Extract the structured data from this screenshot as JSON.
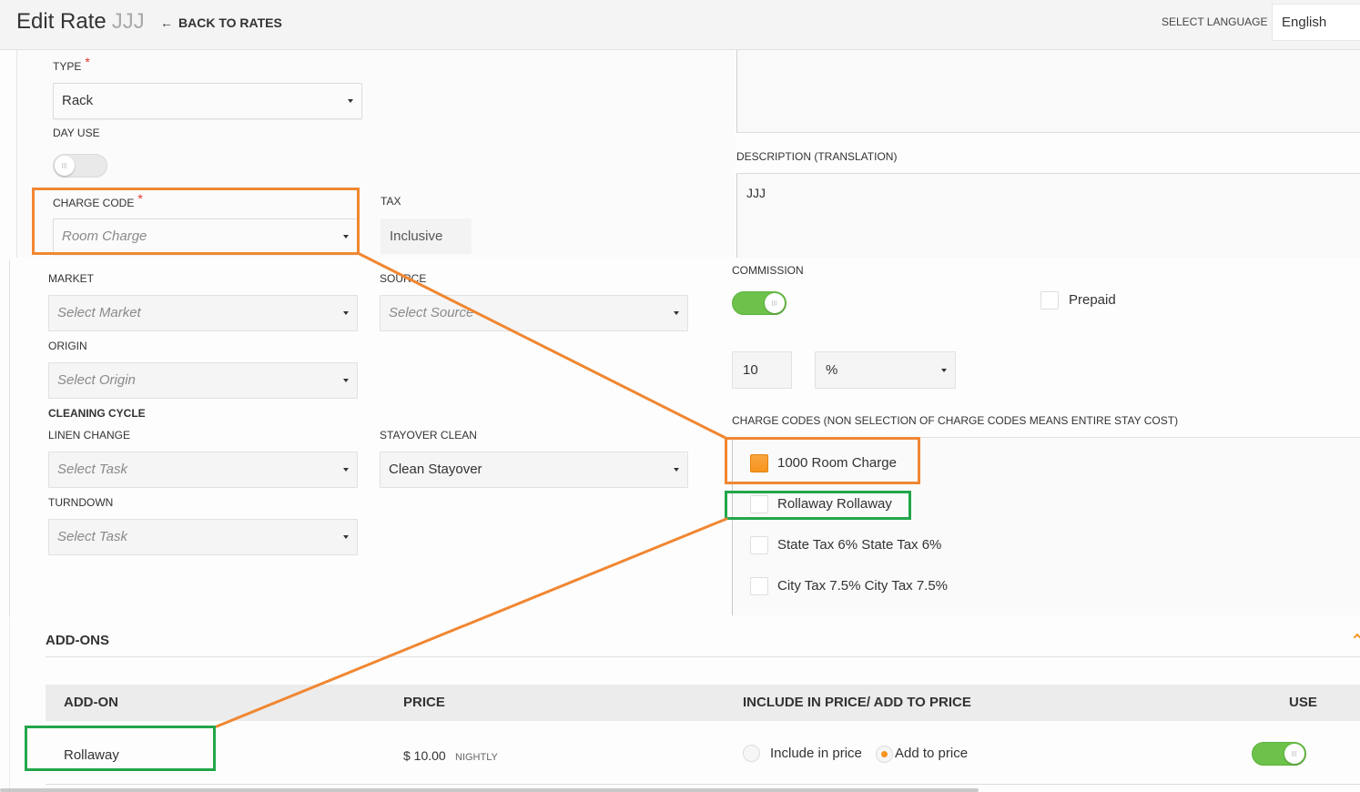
{
  "header": {
    "title": "Edit Rate",
    "rate_name": "JJJ",
    "back_label": "BACK TO RATES",
    "language_label": "SELECT LANGUAGE",
    "language_value": "English"
  },
  "icons": {
    "back": "arrow-left-icon",
    "select_caret": "caret-down-icon",
    "addons_collapse": "chevron-up-icon"
  },
  "colors": {
    "accent": "#f7941d",
    "toggle_on": "#6cc24a",
    "required": "#e2372b",
    "annotation_orange": "#f08732",
    "annotation_green": "#22a64a"
  },
  "form": {
    "required_mark": "*",
    "type": {
      "label": "TYPE",
      "value": "Rack"
    },
    "day_use": {
      "label": "DAY USE",
      "enabled": false
    },
    "charge_code": {
      "label": "CHARGE CODE",
      "placeholder": "Room Charge"
    },
    "tax": {
      "label": "TAX",
      "value": "Inclusive"
    },
    "description_translation": {
      "label": "DESCRIPTION (TRANSLATION)",
      "value": "JJJ"
    },
    "market": {
      "label": "MARKET",
      "placeholder": "Select Market"
    },
    "source": {
      "label": "SOURCE",
      "placeholder": "Select Source"
    },
    "origin": {
      "label": "ORIGIN",
      "placeholder": "Select Origin"
    },
    "cleaning_cycle": {
      "heading": "CLEANING CYCLE",
      "linen_change": {
        "label": "LINEN CHANGE",
        "placeholder": "Select Task"
      },
      "stayover_clean": {
        "label": "STAYOVER CLEAN",
        "value": "Clean Stayover"
      },
      "turndown": {
        "label": "TURNDOWN",
        "placeholder": "Select Task"
      }
    },
    "commission": {
      "label": "COMMISSION",
      "enabled": true,
      "value": "10",
      "unit": "%",
      "prepaid_label": "Prepaid",
      "prepaid": false
    },
    "charge_codes": {
      "label": "CHARGE CODES (NON SELECTION OF CHARGE CODES MEANS ENTIRE STAY COST)",
      "items": [
        {
          "label": "1000 Room Charge",
          "checked": true
        },
        {
          "label": "Rollaway Rollaway",
          "checked": false
        },
        {
          "label": "State Tax 6% State Tax 6%",
          "checked": false
        },
        {
          "label": "City Tax 7.5% City Tax 7.5%",
          "checked": false
        }
      ]
    }
  },
  "addons": {
    "heading": "ADD-ONS",
    "columns": {
      "addon": "ADD-ON",
      "price": "PRICE",
      "include": "INCLUDE IN PRICE/ ADD TO PRICE",
      "use": "USE"
    },
    "rows": [
      {
        "name": "Rollaway",
        "price": "$ 10.00",
        "frequency": "NIGHTLY",
        "include_label": "Include in price",
        "add_label": "Add to price",
        "include_selected": false,
        "add_selected": true,
        "use": true
      }
    ]
  }
}
